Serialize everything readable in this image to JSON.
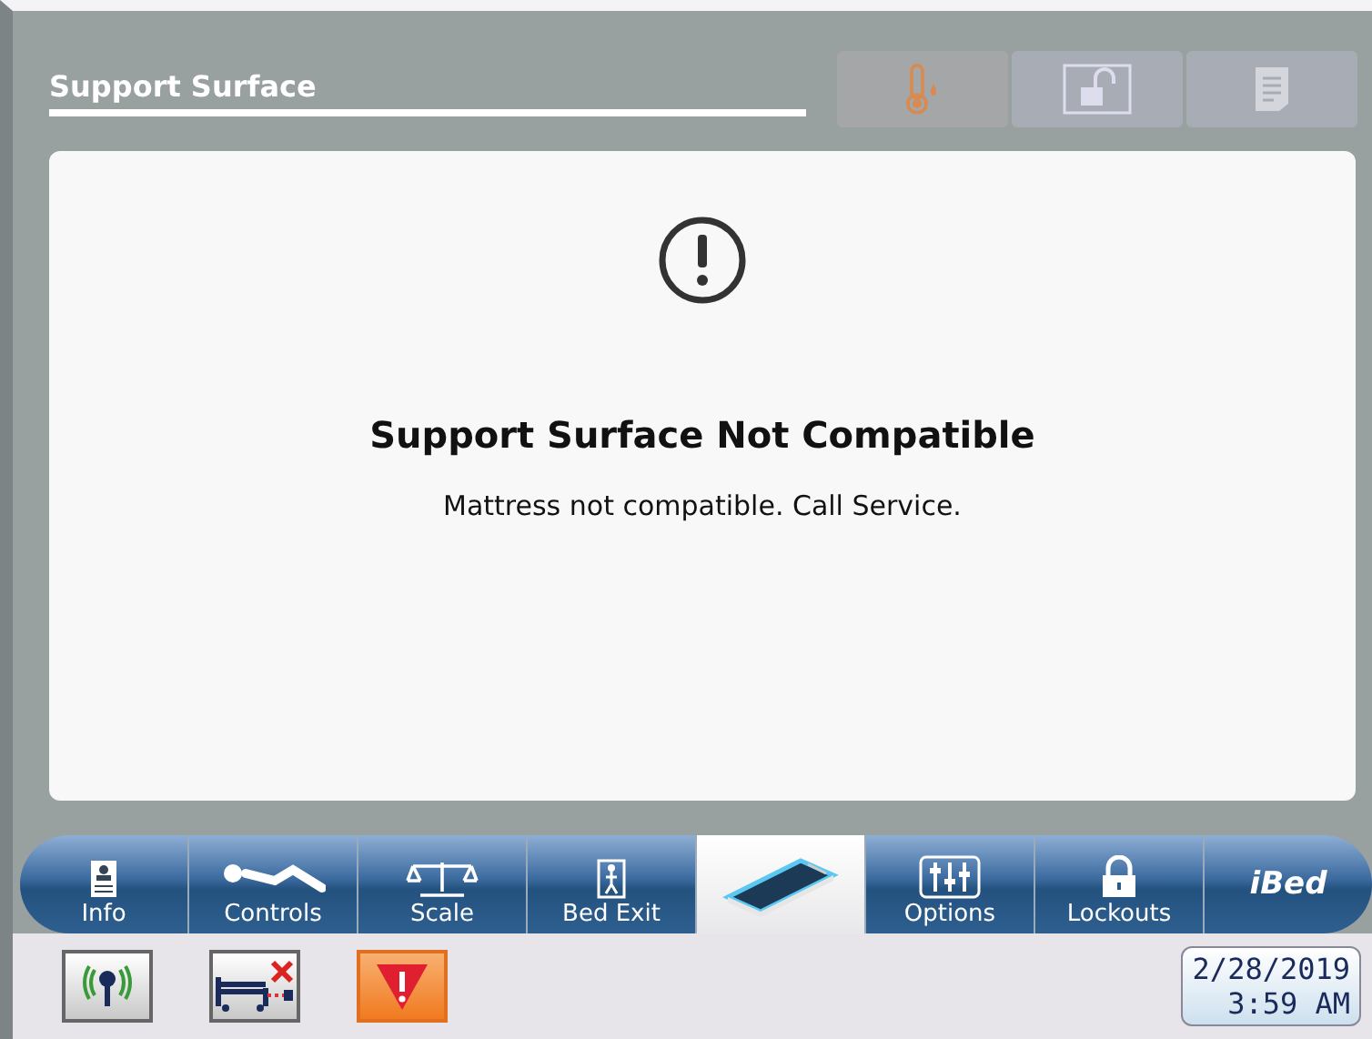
{
  "header": {
    "title": "Support Surface",
    "toolbar_buttons": [
      {
        "disabled": true
      },
      {
        "disabled": true
      },
      {
        "disabled": true
      }
    ]
  },
  "message": {
    "title": "Support Surface Not Compatible",
    "body": "Mattress not compatible. Call Service."
  },
  "tabs": [
    {
      "label": "Info",
      "selected": false
    },
    {
      "label": "Controls",
      "selected": false
    },
    {
      "label": "Scale",
      "selected": false
    },
    {
      "label": "Bed Exit",
      "selected": false
    },
    {
      "selected": true
    },
    {
      "label": "Options",
      "selected": false
    },
    {
      "label": "Lockouts",
      "selected": false
    },
    {
      "label": "iBed",
      "selected": false
    }
  ],
  "status_bar": {
    "date": "2/28/2019",
    "time": "3:59 AM"
  }
}
